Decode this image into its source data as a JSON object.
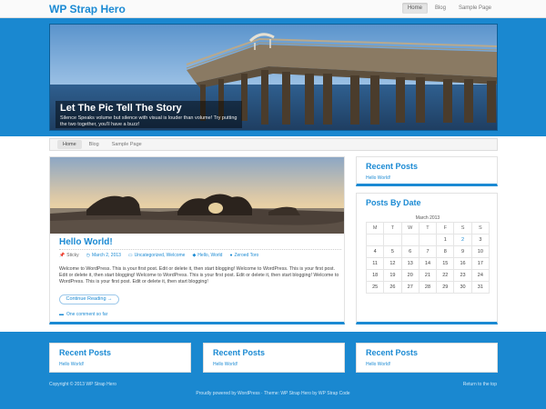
{
  "header": {
    "brand": "WP Strap Hero",
    "nav": [
      "Home",
      "Blog",
      "Sample Page"
    ]
  },
  "hero": {
    "title": "Let The Pic Tell The Story",
    "text": "Silence Speaks volume but silence with visual is louder than volume! Try putting the two together, you'll have a buzz!"
  },
  "subnav": [
    "Home",
    "Blog",
    "Sample Page"
  ],
  "post": {
    "title": "Hello World!",
    "meta": {
      "sticky": "Sticky",
      "date": "March 2, 2013",
      "categories": "Uncategorized, Welcome",
      "tags": "Hello, World",
      "author": "Zeroed Toro"
    },
    "body": "Welcome to WordPress. This is your first post. Edit or delete it, then start blogging! Welcome to WordPress. This is your first post. Edit or delete it, then start blogging! Welcome to WordPress. This is your first post. Edit or delete it, then start blogging! Welcome to WordPress. This is your first post. Edit or delete it, then start blogging!",
    "continue": "Continue Reading →",
    "comments": "One comment so far"
  },
  "sidebar": {
    "recent_title": "Recent Posts",
    "recent_link": "Hello World!",
    "date_title": "Posts By Date",
    "calendar": {
      "caption": "March 2013",
      "days": [
        "M",
        "T",
        "W",
        "T",
        "F",
        "S",
        "S"
      ],
      "weeks": [
        [
          "",
          "",
          "",
          "",
          "1",
          "2",
          "3"
        ],
        [
          "4",
          "5",
          "6",
          "7",
          "8",
          "9",
          "10"
        ],
        [
          "11",
          "12",
          "13",
          "14",
          "15",
          "16",
          "17"
        ],
        [
          "18",
          "19",
          "20",
          "21",
          "22",
          "23",
          "24"
        ],
        [
          "25",
          "26",
          "27",
          "28",
          "29",
          "30",
          "31"
        ]
      ],
      "linked_days": [
        "2"
      ]
    }
  },
  "footer_widgets": [
    {
      "title": "Recent Posts",
      "link": "Hello World!"
    },
    {
      "title": "Recent Posts",
      "link": "Hello World!"
    },
    {
      "title": "Recent Posts",
      "link": "Hello World!"
    }
  ],
  "footer": {
    "copyright": "Copyright © 2013 WP Strap Hero",
    "to_top": "Return to the top",
    "powered": "Proudly powered by WordPress · Theme: WP Strap Hero by WP Strap Code"
  },
  "colors": {
    "accent": "#1b8ad3",
    "background": "#1a88d0"
  }
}
